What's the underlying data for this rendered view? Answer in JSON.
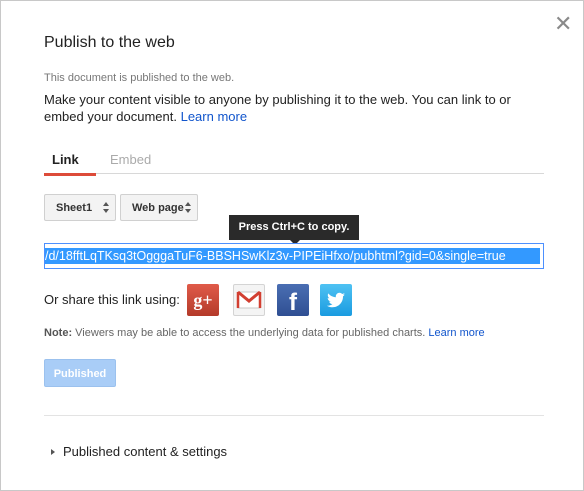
{
  "dialog": {
    "title": "Publish to the web",
    "close_icon": "close-icon",
    "status": "This document is published to the web.",
    "description": "Make your content visible to anyone by publishing it to the web. You can link to or embed your document.",
    "learn_more": "Learn more"
  },
  "tabs": [
    {
      "label": "Link",
      "active": true
    },
    {
      "label": "Embed",
      "active": false
    }
  ],
  "selects": {
    "sheet": "Sheet1",
    "format": "Web page"
  },
  "tooltip": "Press Ctrl+C to copy.",
  "url": "/d/18fftLqTKsq3tOgggaTuF6-BBSHSwKlz3v-PIPEiHfxo/pubhtml?gid=0&single=true",
  "share": {
    "label": "Or share this link using:",
    "icons": [
      "google-plus-icon",
      "gmail-icon",
      "facebook-icon",
      "twitter-icon"
    ]
  },
  "note": {
    "prefix": "Note:",
    "text": "Viewers may be able to access the underlying data for published charts.",
    "learn_more": "Learn more"
  },
  "published_button": "Published",
  "expand_label": "Published content & settings",
  "colors": {
    "accent_red": "#dd4b39",
    "link_blue": "#1155cc",
    "selection_blue": "#3399ff"
  }
}
